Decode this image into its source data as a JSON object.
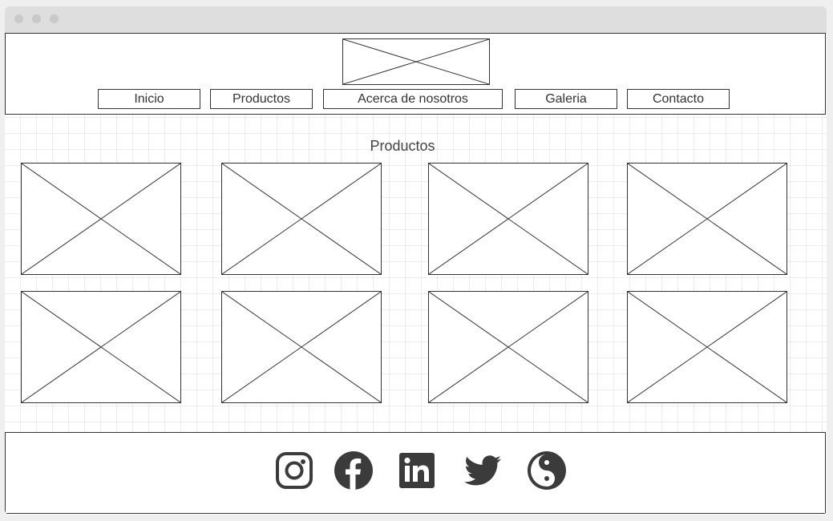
{
  "nav": {
    "items": [
      {
        "label": "Inicio"
      },
      {
        "label": "Productos"
      },
      {
        "label": "Acerca de nosotros"
      },
      {
        "label": "Galeria"
      },
      {
        "label": "Contacto"
      }
    ]
  },
  "main": {
    "section_title": "Productos",
    "products": [
      {
        "icon": "image-placeholder-icon"
      },
      {
        "icon": "image-placeholder-icon"
      },
      {
        "icon": "image-placeholder-icon"
      },
      {
        "icon": "image-placeholder-icon"
      },
      {
        "icon": "image-placeholder-icon"
      },
      {
        "icon": "image-placeholder-icon"
      },
      {
        "icon": "image-placeholder-icon"
      },
      {
        "icon": "image-placeholder-icon"
      }
    ]
  },
  "header": {
    "logo_icon": "image-placeholder-icon"
  },
  "footer": {
    "social_icons": [
      "instagram-icon",
      "facebook-icon",
      "linkedin-icon",
      "twitter-icon",
      "yin-yang-icon"
    ]
  },
  "colors": {
    "stroke": "#333333",
    "icon_fill": "#3b3b3b",
    "grid": "#ececec",
    "titlebar": "#dedede"
  }
}
